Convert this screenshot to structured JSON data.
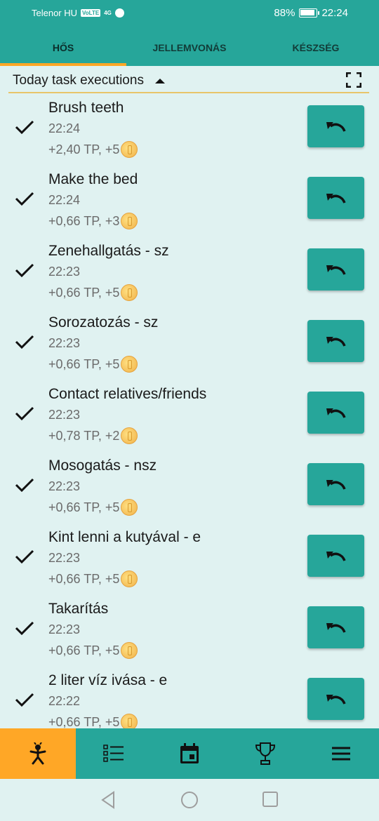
{
  "status_bar": {
    "carrier": "Telenor HU",
    "volte": "VoLTE",
    "network": "4G",
    "battery": "88%",
    "time": "22:24"
  },
  "tabs": [
    {
      "label": "HŐS",
      "active": true
    },
    {
      "label": "JELLEMVONÁS",
      "active": false
    },
    {
      "label": "KÉSZSÉG",
      "active": false
    }
  ],
  "section": {
    "title": "Today task executions",
    "toggle_icon": "caret-up-icon",
    "fullscreen_icon": "fullscreen-icon"
  },
  "tasks": [
    {
      "name": "Brush teeth",
      "time": "22:24",
      "reward": "+2,40 TP, +5"
    },
    {
      "name": "Make the bed",
      "time": "22:24",
      "reward": "+0,66 TP, +3"
    },
    {
      "name": "Zenehallgatás - sz",
      "time": "22:23",
      "reward": "+0,66 TP, +5"
    },
    {
      "name": "Sorozatozás - sz",
      "time": "22:23",
      "reward": "+0,66 TP, +5"
    },
    {
      "name": "Contact relatives/friends",
      "time": "22:23",
      "reward": "+0,78 TP, +2"
    },
    {
      "name": "Mosogatás - nsz",
      "time": "22:23",
      "reward": "+0,66 TP, +5"
    },
    {
      "name": "Kint lenni a kutyával - e",
      "time": "22:23",
      "reward": "+0,66 TP, +5"
    },
    {
      "name": "Takarítás",
      "time": "22:23",
      "reward": "+0,66 TP, +5"
    },
    {
      "name": "2 liter víz ivása - e",
      "time": "22:22",
      "reward": "+0,66 TP, +5"
    }
  ],
  "bottom_nav": [
    {
      "icon": "hero-icon",
      "active": true
    },
    {
      "icon": "list-icon",
      "active": false
    },
    {
      "icon": "calendar-icon",
      "active": false
    },
    {
      "icon": "trophy-icon",
      "active": false
    },
    {
      "icon": "menu-icon",
      "active": false
    }
  ],
  "system_nav": [
    "back-icon",
    "home-icon",
    "recents-icon"
  ],
  "colors": {
    "primary": "#26a69a",
    "accent": "#ffa726",
    "background": "#e0f2f1",
    "coin": "#f0b24a"
  }
}
